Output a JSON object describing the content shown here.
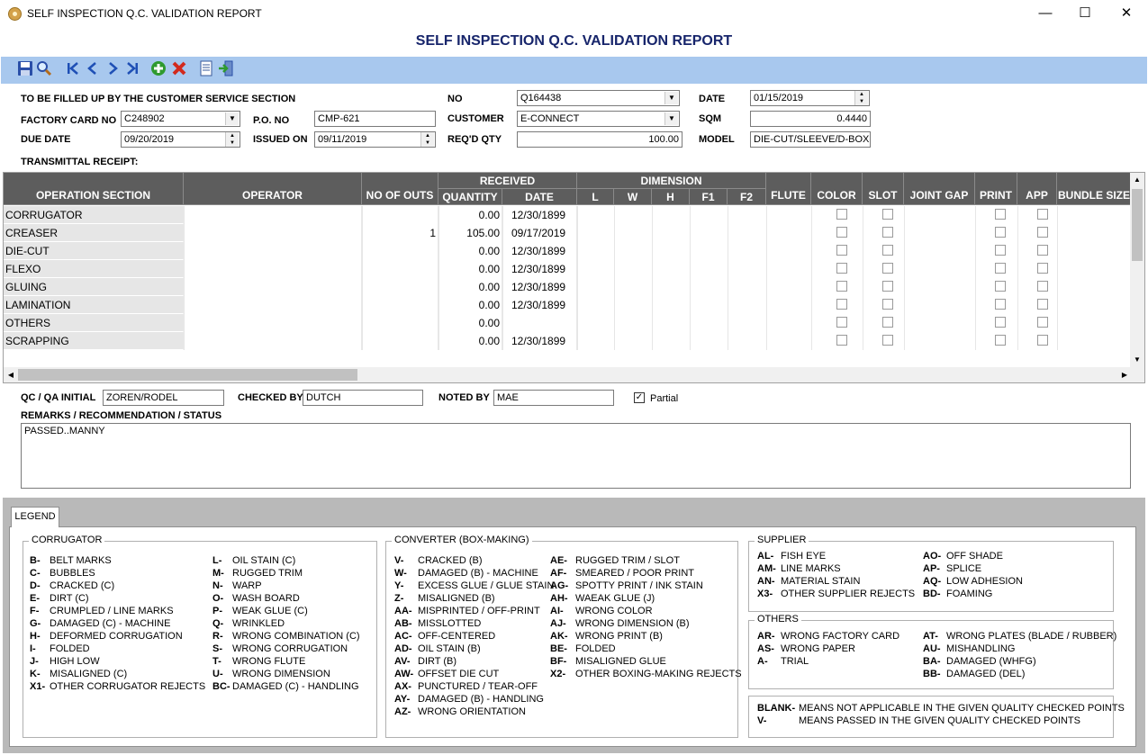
{
  "window": {
    "title": "SELF INSPECTION Q.C. VALIDATION REPORT",
    "minimize_glyph": "—",
    "maximize_glyph": "☐",
    "close_glyph": "✕"
  },
  "heading": "SELF INSPECTION Q.C. VALIDATION REPORT",
  "toolbar": {
    "icons": [
      "save-icon",
      "search-icon",
      "first-record-icon",
      "previous-record-icon",
      "next-record-icon",
      "last-record-icon",
      "add-icon",
      "delete-icon",
      "report-icon",
      "exit-icon"
    ]
  },
  "form": {
    "section_label": "TO BE FILLED UP BY THE CUSTOMER SERVICE SECTION",
    "factory_card_label": "FACTORY CARD NO",
    "factory_card_value": "C248902",
    "po_label": "P.O. NO",
    "po_value": "CMP-621",
    "due_date_label": "DUE DATE",
    "due_date_value": "09/20/2019",
    "issued_on_label": "ISSUED ON",
    "issued_on_value": "09/11/2019",
    "no_label": "NO",
    "no_value": "Q164438",
    "customer_label": "CUSTOMER",
    "customer_value": "E-CONNECT",
    "reqd_qty_label": "REQ'D QTY",
    "reqd_qty_value": "100.00",
    "date_label": "DATE",
    "date_value": "01/15/2019",
    "sqm_label": "SQM",
    "sqm_value": "0.4440",
    "model_label": "MODEL",
    "model_value": "DIE-CUT/SLEEVE/D-BOX",
    "transmittal_label": "TRANSMITTAL RECEIPT:"
  },
  "grid": {
    "headers": {
      "operation_section": "OPERATION SECTION",
      "operator": "OPERATOR",
      "no_of_outs": "NO OF OUTS",
      "received": "RECEIVED",
      "quantity": "QUANTITY",
      "date": "DATE",
      "dimension": "DIMENSION",
      "l": "L",
      "w": "W",
      "h": "H",
      "f1": "F1",
      "f2": "F2",
      "flute": "FLUTE",
      "color": "COLOR",
      "slot": "SLOT",
      "joint_gap": "JOINT GAP",
      "print": "PRINT",
      "app": "APP",
      "bundle_size": "BUNDLE SIZE"
    },
    "rows": [
      {
        "section": "CORRUGATOR",
        "outs": "",
        "quantity": "0.00",
        "date": "12/30/1899"
      },
      {
        "section": "CREASER",
        "outs": "1",
        "quantity": "105.00",
        "date": "09/17/2019"
      },
      {
        "section": "DIE-CUT",
        "outs": "",
        "quantity": "0.00",
        "date": "12/30/1899"
      },
      {
        "section": "FLEXO",
        "outs": "",
        "quantity": "0.00",
        "date": "12/30/1899"
      },
      {
        "section": "GLUING",
        "outs": "",
        "quantity": "0.00",
        "date": "12/30/1899"
      },
      {
        "section": "LAMINATION",
        "outs": "",
        "quantity": "0.00",
        "date": "12/30/1899"
      },
      {
        "section": "OTHERS",
        "outs": "",
        "quantity": "0.00",
        "date": ""
      },
      {
        "section": "SCRAPPING",
        "outs": "",
        "quantity": "0.00",
        "date": "12/30/1899"
      }
    ]
  },
  "signoff": {
    "qc_label": "QC / QA INITIAL",
    "qc_value": "ZOREN/RODEL",
    "checked_label": "CHECKED BY",
    "checked_value": "DUTCH",
    "noted_label": "NOTED BY",
    "noted_value": "MAE",
    "partial_label": "Partial",
    "partial_checked": true,
    "remarks_label": "REMARKS / RECOMMENDATION / STATUS",
    "remarks_value": "PASSED..MANNY"
  },
  "legend": {
    "tab_label": "LEGEND",
    "corrugator": {
      "title": "CORRUGATOR",
      "col1": [
        {
          "code": "B-",
          "desc": "BELT MARKS"
        },
        {
          "code": "C-",
          "desc": "BUBBLES"
        },
        {
          "code": "D-",
          "desc": "CRACKED (C)"
        },
        {
          "code": "E-",
          "desc": "DIRT (C)"
        },
        {
          "code": "F-",
          "desc": "CRUMPLED / LINE MARKS"
        },
        {
          "code": "G-",
          "desc": "DAMAGED (C) - MACHINE"
        },
        {
          "code": "H-",
          "desc": "DEFORMED CORRUGATION"
        },
        {
          "code": "I-",
          "desc": "FOLDED"
        },
        {
          "code": "J-",
          "desc": "HIGH LOW"
        },
        {
          "code": "K-",
          "desc": "MISALIGNED (C)"
        },
        {
          "code": "X1-",
          "desc": "OTHER CORRUGATOR REJECTS"
        }
      ],
      "col2": [
        {
          "code": "L-",
          "desc": "OIL STAIN (C)"
        },
        {
          "code": "M-",
          "desc": "RUGGED TRIM"
        },
        {
          "code": "N-",
          "desc": "WARP"
        },
        {
          "code": "O-",
          "desc": "WASH BOARD"
        },
        {
          "code": "P-",
          "desc": "WEAK GLUE (C)"
        },
        {
          "code": "Q-",
          "desc": "WRINKLED"
        },
        {
          "code": "R-",
          "desc": "WRONG COMBINATION (C)"
        },
        {
          "code": "S-",
          "desc": "WRONG CORRUGATION"
        },
        {
          "code": "T-",
          "desc": "WRONG FLUTE"
        },
        {
          "code": "U-",
          "desc": "WRONG DIMENSION"
        },
        {
          "code": "BC-",
          "desc": "DAMAGED (C) - HANDLING"
        }
      ]
    },
    "converter": {
      "title": "CONVERTER (BOX-MAKING)",
      "col1": [
        {
          "code": "V-",
          "desc": "CRACKED (B)"
        },
        {
          "code": "W-",
          "desc": "DAMAGED (B) - MACHINE"
        },
        {
          "code": "Y-",
          "desc": "EXCESS GLUE / GLUE STAIN"
        },
        {
          "code": "Z-",
          "desc": "MISALIGNED (B)"
        },
        {
          "code": "AA-",
          "desc": "MISPRINTED / OFF-PRINT"
        },
        {
          "code": "AB-",
          "desc": "MISSLOTTED"
        },
        {
          "code": "AC-",
          "desc": "OFF-CENTERED"
        },
        {
          "code": "AD-",
          "desc": "OIL STAIN (B)"
        },
        {
          "code": "AV-",
          "desc": "DIRT (B)"
        },
        {
          "code": "AW-",
          "desc": "OFFSET DIE CUT"
        },
        {
          "code": "AX-",
          "desc": "PUNCTURED / TEAR-OFF"
        },
        {
          "code": "AY-",
          "desc": "DAMAGED (B) - HANDLING"
        },
        {
          "code": "AZ-",
          "desc": "WRONG ORIENTATION"
        }
      ],
      "col2": [
        {
          "code": "AE-",
          "desc": "RUGGED TRIM / SLOT"
        },
        {
          "code": "AF-",
          "desc": "SMEARED / POOR PRINT"
        },
        {
          "code": "AG-",
          "desc": "SPOTTY PRINT / INK STAIN"
        },
        {
          "code": "AH-",
          "desc": "WAEAK GLUE (J)"
        },
        {
          "code": "AI-",
          "desc": "WRONG COLOR"
        },
        {
          "code": "AJ-",
          "desc": "WRONG DIMENSION (B)"
        },
        {
          "code": "AK-",
          "desc": "WRONG PRINT (B)"
        },
        {
          "code": "BE-",
          "desc": "FOLDED"
        },
        {
          "code": "BF-",
          "desc": "MISALIGNED GLUE"
        },
        {
          "code": "X2-",
          "desc": "OTHER BOXING-MAKING REJECTS"
        }
      ]
    },
    "supplier": {
      "title": "SUPPLIER",
      "col1": [
        {
          "code": "AL-",
          "desc": "FISH EYE"
        },
        {
          "code": "AM-",
          "desc": "LINE MARKS"
        },
        {
          "code": "AN-",
          "desc": "MATERIAL STAIN"
        },
        {
          "code": "X3-",
          "desc": "OTHER SUPPLIER REJECTS"
        }
      ],
      "col2": [
        {
          "code": "AO-",
          "desc": "OFF SHADE"
        },
        {
          "code": "AP-",
          "desc": "SPLICE"
        },
        {
          "code": "AQ-",
          "desc": "LOW ADHESION"
        },
        {
          "code": "BD-",
          "desc": "FOAMING"
        }
      ]
    },
    "others": {
      "title": "OTHERS",
      "col1": [
        {
          "code": "AR-",
          "desc": "WRONG FACTORY CARD"
        },
        {
          "code": "AS-",
          "desc": "WRONG PAPER"
        },
        {
          "code": "A-",
          "desc": "TRIAL"
        }
      ],
      "col2": [
        {
          "code": "AT-",
          "desc": "WRONG PLATES (BLADE / RUBBER)"
        },
        {
          "code": "AU-",
          "desc": "MISHANDLING"
        },
        {
          "code": "BA-",
          "desc": "DAMAGED (WHFG)"
        },
        {
          "code": "BB-",
          "desc": "DAMAGED (DEL)"
        }
      ]
    },
    "notes": [
      {
        "code": "BLANK-",
        "desc": "MEANS NOT APPLICABLE IN THE GIVEN QUALITY CHECKED POINTS"
      },
      {
        "code": "V-",
        "desc": "MEANS PASSED IN THE GIVEN QUALITY CHECKED POINTS"
      }
    ]
  }
}
